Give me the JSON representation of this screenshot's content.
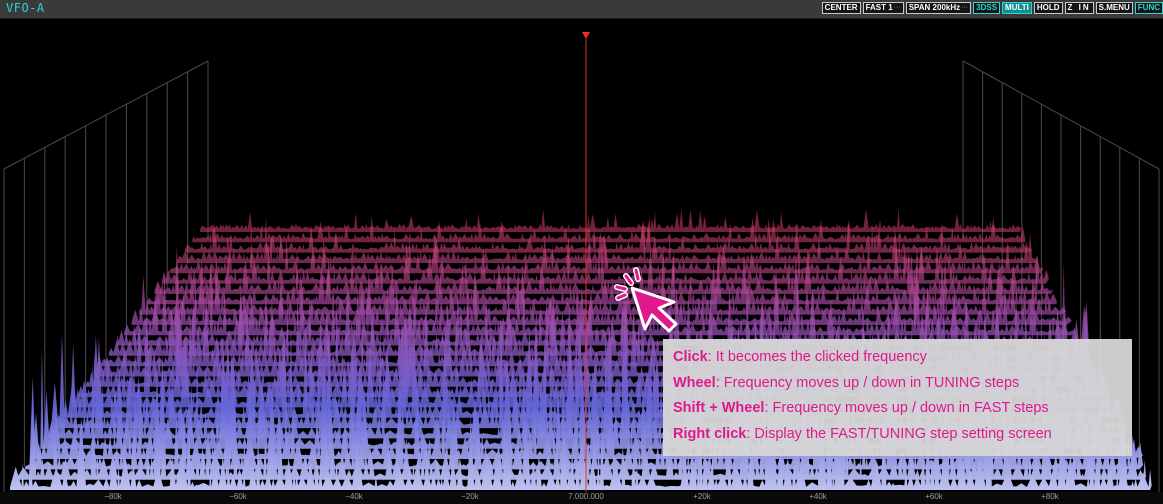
{
  "header": {
    "vfo_label": "VFO-A",
    "buttons": [
      {
        "label": "CENTER",
        "sub": "",
        "style": "normal"
      },
      {
        "label": "FAST 1",
        "sub": "···",
        "style": "normal"
      },
      {
        "label": "SPAN  200kHz",
        "sub": "···",
        "style": "normal"
      },
      {
        "label": "3DSS",
        "sub": "",
        "style": "cyan"
      },
      {
        "label": "MULTI",
        "sub": "",
        "style": "cyanfill"
      },
      {
        "label": "HOLD",
        "sub": "",
        "style": "normal"
      },
      {
        "label": "Z IN",
        "sub": "",
        "style": "wide"
      },
      {
        "label": "S.MENU",
        "sub": "",
        "style": "normal"
      },
      {
        "label": "FUNC",
        "sub": "",
        "style": "cyan"
      }
    ]
  },
  "frequency_axis": {
    "labels": [
      "−80k",
      "−60k",
      "−40k",
      "−20k",
      "7.000.000",
      "+20k",
      "+40k",
      "+60k",
      "+80k"
    ],
    "center_line_color": "#e8312a",
    "center_marker": "triangle-down-icon"
  },
  "colors": {
    "peak_top": "#e03a4e",
    "peak_mid": "#a24aa8",
    "peak_low": "#6466d8",
    "peak_floor": "#bfc4f0",
    "highlight": "#e0188c"
  },
  "tooltip": {
    "lines": [
      {
        "key": "Click",
        "text": ": It becomes the clicked frequency"
      },
      {
        "key": "Wheel",
        "text": ": Frequency moves up / down in TUNING steps"
      },
      {
        "key": "Shift + Wheel",
        "text": ": Frequency moves up / down in FAST steps"
      },
      {
        "key": "Right click",
        "text": ": Display the FAST/TUNING step setting screen"
      }
    ]
  },
  "cursor_icon": "hand-pointer-click-icon"
}
